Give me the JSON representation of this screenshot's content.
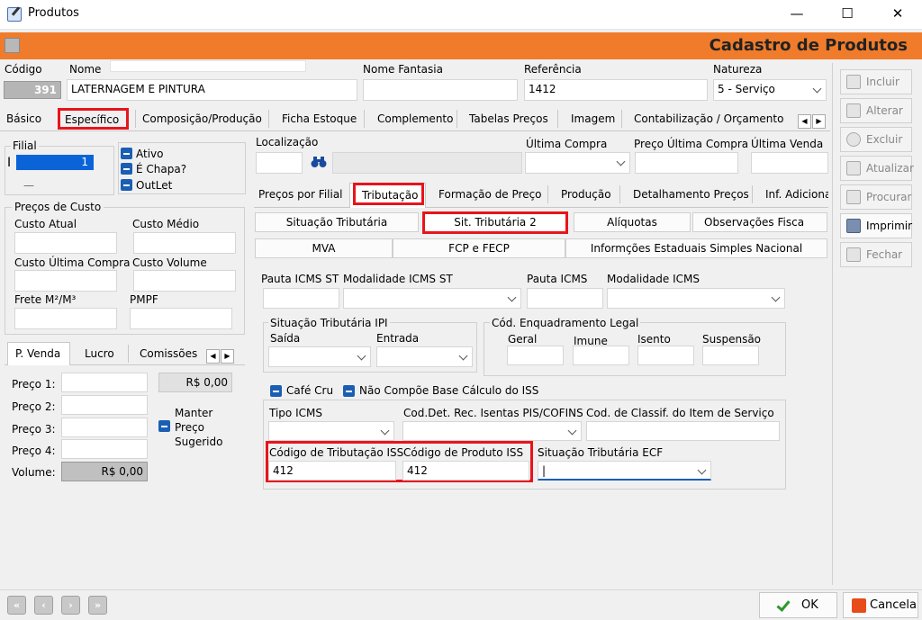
{
  "window": {
    "title": "Produtos"
  },
  "header": {
    "title": "Cadastro de Produtos"
  },
  "top": {
    "codigo_label": "Código",
    "codigo_value": "391",
    "nome_label": "Nome",
    "nome_value": "LATERNAGEM E PINTURA",
    "fantasia_label": "Nome Fantasia",
    "fantasia_value": "",
    "referencia_label": "Referência",
    "referencia_value": "1412",
    "natureza_label": "Natureza",
    "natureza_value": "5 - Serviço"
  },
  "main_tabs": [
    "Básico",
    "Específico",
    "Composição/Produção",
    "Ficha Estoque",
    "Complemento",
    "Tabelas Preços",
    "Imagem",
    "Contabilização / Orçamento"
  ],
  "filial": {
    "label": "Filial",
    "value": "1",
    "cursor": "I",
    "dash": "—"
  },
  "flags": [
    "Ativo",
    "É Chapa?",
    "OutLet"
  ],
  "custos": {
    "legend": "Preços de Custo",
    "labels": [
      "Custo Atual",
      "Custo Médio",
      "Custo Última Compra",
      "Custo Volume",
      "Frete M²/M³",
      "PMPF"
    ]
  },
  "venda_tabs": [
    "P. Venda",
    "Lucro",
    "Comissões"
  ],
  "venda": {
    "precos": [
      "Preço 1:",
      "Preço 2:",
      "Preço 3:",
      "Preço 4:"
    ],
    "valor": "R$ 0,00",
    "volume_label": "Volume:",
    "volume_value": "R$ 0,00",
    "manter": [
      "Manter",
      "Preço",
      "Sugerido"
    ]
  },
  "localizacao": {
    "label": "Localização",
    "ultima_compra": "Última Compra",
    "preco_ultima_compra": "Preço Última Compra",
    "ultima_venda": "Última Venda"
  },
  "sub_tabs": [
    "Preços por Filial",
    "Tributação",
    "Formação de Preço",
    "Produção",
    "Detalhamento Preços",
    "Inf. Adiciona"
  ],
  "trib_buttons_row1": [
    "Situação Tributária",
    "Sit. Tributária 2",
    "Alíquotas",
    "Observações Fisca"
  ],
  "trib_buttons_row2": [
    "MVA",
    "FCP e FECP",
    "Informções Estaduais Simples Nacional"
  ],
  "icms": {
    "pauta_st": "Pauta ICMS ST",
    "modalidade_st": "Modalidade ICMS ST",
    "pauta": "Pauta ICMS",
    "modalidade": "Modalidade ICMS"
  },
  "ipi": {
    "legend": "Situação Tributária IPI",
    "saida": "Saída",
    "entrada": "Entrada"
  },
  "enquadramento": {
    "legend": "Cód. Enquadramento Legal",
    "geral": "Geral",
    "imune": "Imune",
    "isento": "Isento",
    "suspensao": "Suspensão"
  },
  "checks2": [
    "Café Cru",
    "Não Compõe Base Cálculo do ISS"
  ],
  "iss": {
    "tipo_icms": "Tipo ICMS",
    "pis_cofins": "Cod.Det. Rec. Isentas PIS/COFINS",
    "classif": "Cod. de Classif. do Item de Serviço",
    "cod_trib_label": "Código de Tributação ISS",
    "cod_trib_value": "412",
    "cod_prod_label": "Código de Produto ISS",
    "cod_prod_value": "412",
    "ecf_label": "Situação Tributária ECF",
    "ecf_value": "|"
  },
  "side_buttons": [
    "Incluir",
    "Alterar",
    "Excluir",
    "Atualizar",
    "Procurar",
    "Imprimir",
    "Fechar"
  ],
  "footer": {
    "ok": "OK",
    "cancel": "Cancela",
    "nav": [
      "«",
      "‹",
      "›",
      "»"
    ]
  },
  "arrows": {
    "left": "◀",
    "right": "▶"
  }
}
